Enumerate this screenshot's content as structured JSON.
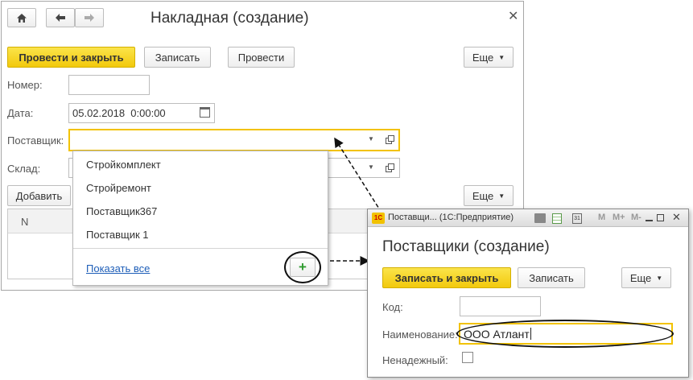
{
  "main": {
    "title": "Накладная (создание)",
    "toolbar": {
      "post_close": "Провести и закрыть",
      "save": "Записать",
      "post": "Провести",
      "more": "Еще"
    },
    "fields": {
      "number_label": "Номер:",
      "number_value": "",
      "date_label": "Дата:",
      "date_value": "05.02.2018  0:00:00",
      "supplier_label": "Поставщик:",
      "supplier_value": "",
      "warehouse_label": "Склад:"
    },
    "table": {
      "add": "Добавить",
      "more": "Еще",
      "columns": [
        "N"
      ]
    }
  },
  "dropdown": {
    "items": [
      "Стройкомплект",
      "Стройремонт",
      "Поставщик367",
      "Поставщик 1"
    ],
    "show_all": "Показать все",
    "add_symbol": "+"
  },
  "sub": {
    "titlebar": "Поставщи... (1С:Предприятие)",
    "app_icon": "1С",
    "calc_buttons": [
      "M",
      "M+",
      "M-"
    ],
    "title": "Поставщики (создание)",
    "toolbar": {
      "save_close": "Записать и закрыть",
      "save": "Записать",
      "more": "Еще"
    },
    "fields": {
      "code_label": "Код:",
      "code_value": "",
      "name_label": "Наименование:",
      "name_value": "ООО Атлант",
      "unreliable_label": "Ненадежный:"
    }
  },
  "colors": {
    "accent_yellow": "#f2c90c",
    "focus_border": "#f2c200",
    "link": "#1e5eb8",
    "add_green": "#2e9b2e"
  }
}
